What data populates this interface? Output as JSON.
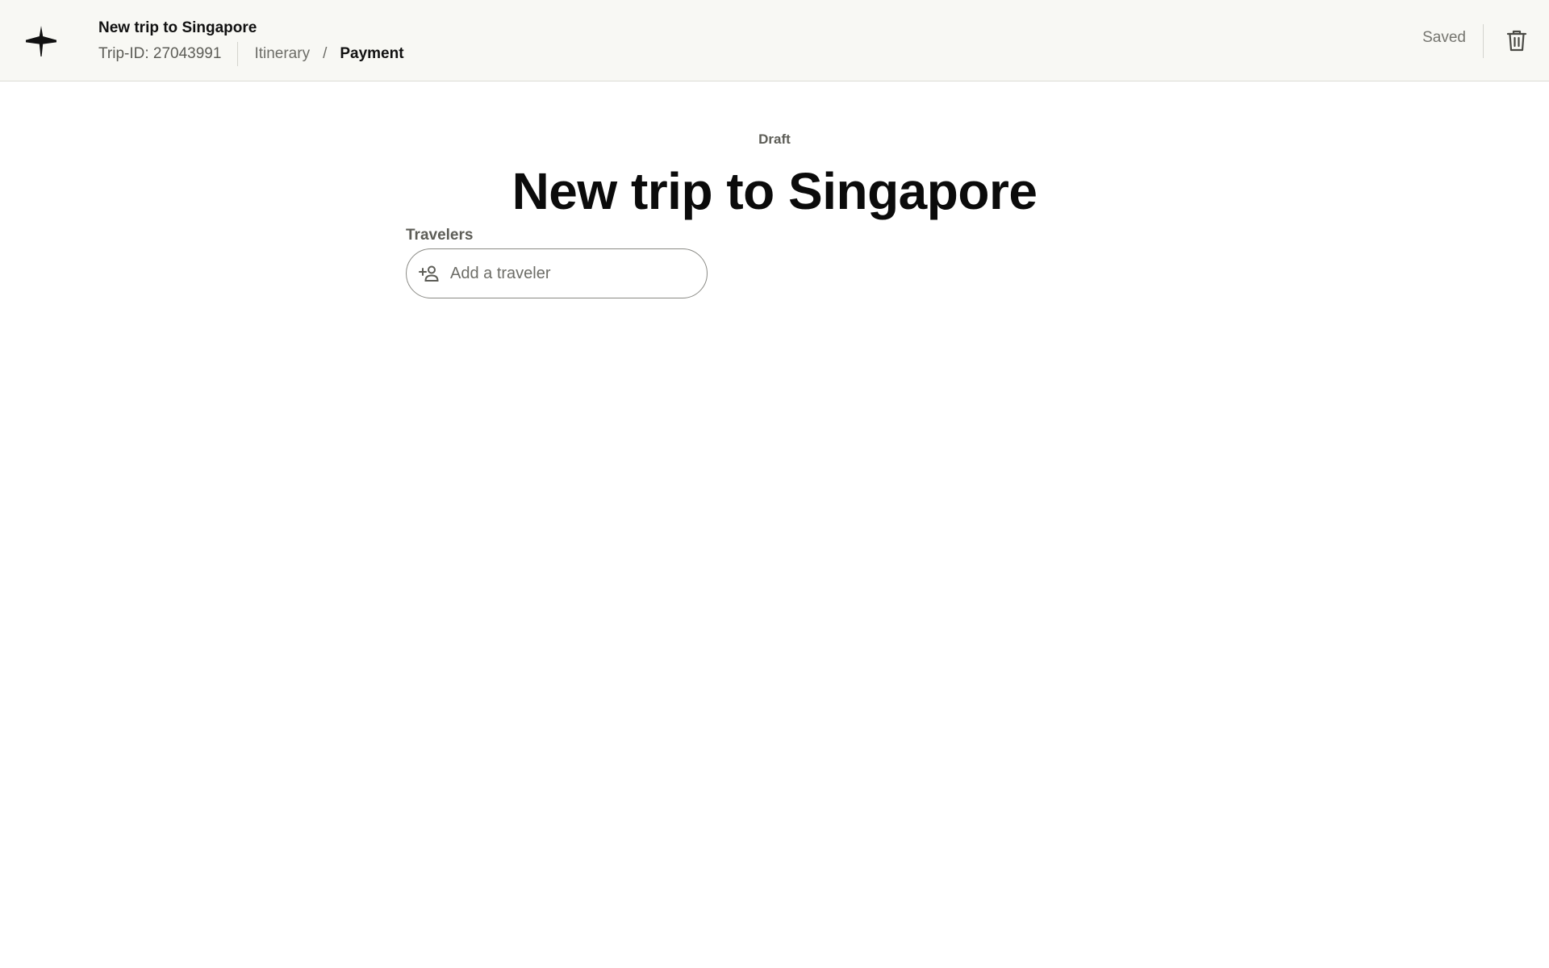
{
  "header": {
    "logo_icon": "plane-icon",
    "title": "New trip to Singapore",
    "trip_id": "Trip-ID: 27043991",
    "breadcrumb": [
      {
        "label": "Itinerary",
        "active": false
      },
      {
        "label": "Payment",
        "active": true
      }
    ],
    "breadcrumb_separator": "/",
    "save_status": "Saved",
    "delete_icon": "trash-icon"
  },
  "main": {
    "status": "Draft",
    "title": "New trip to Singapore",
    "travelers": {
      "label": "Travelers",
      "placeholder": "Add a traveler",
      "value": "",
      "icon": "add-person-icon"
    }
  },
  "colors": {
    "header_bg": "#f8f8f4",
    "text_primary": "#111111",
    "text_secondary": "#5d5d57"
  }
}
